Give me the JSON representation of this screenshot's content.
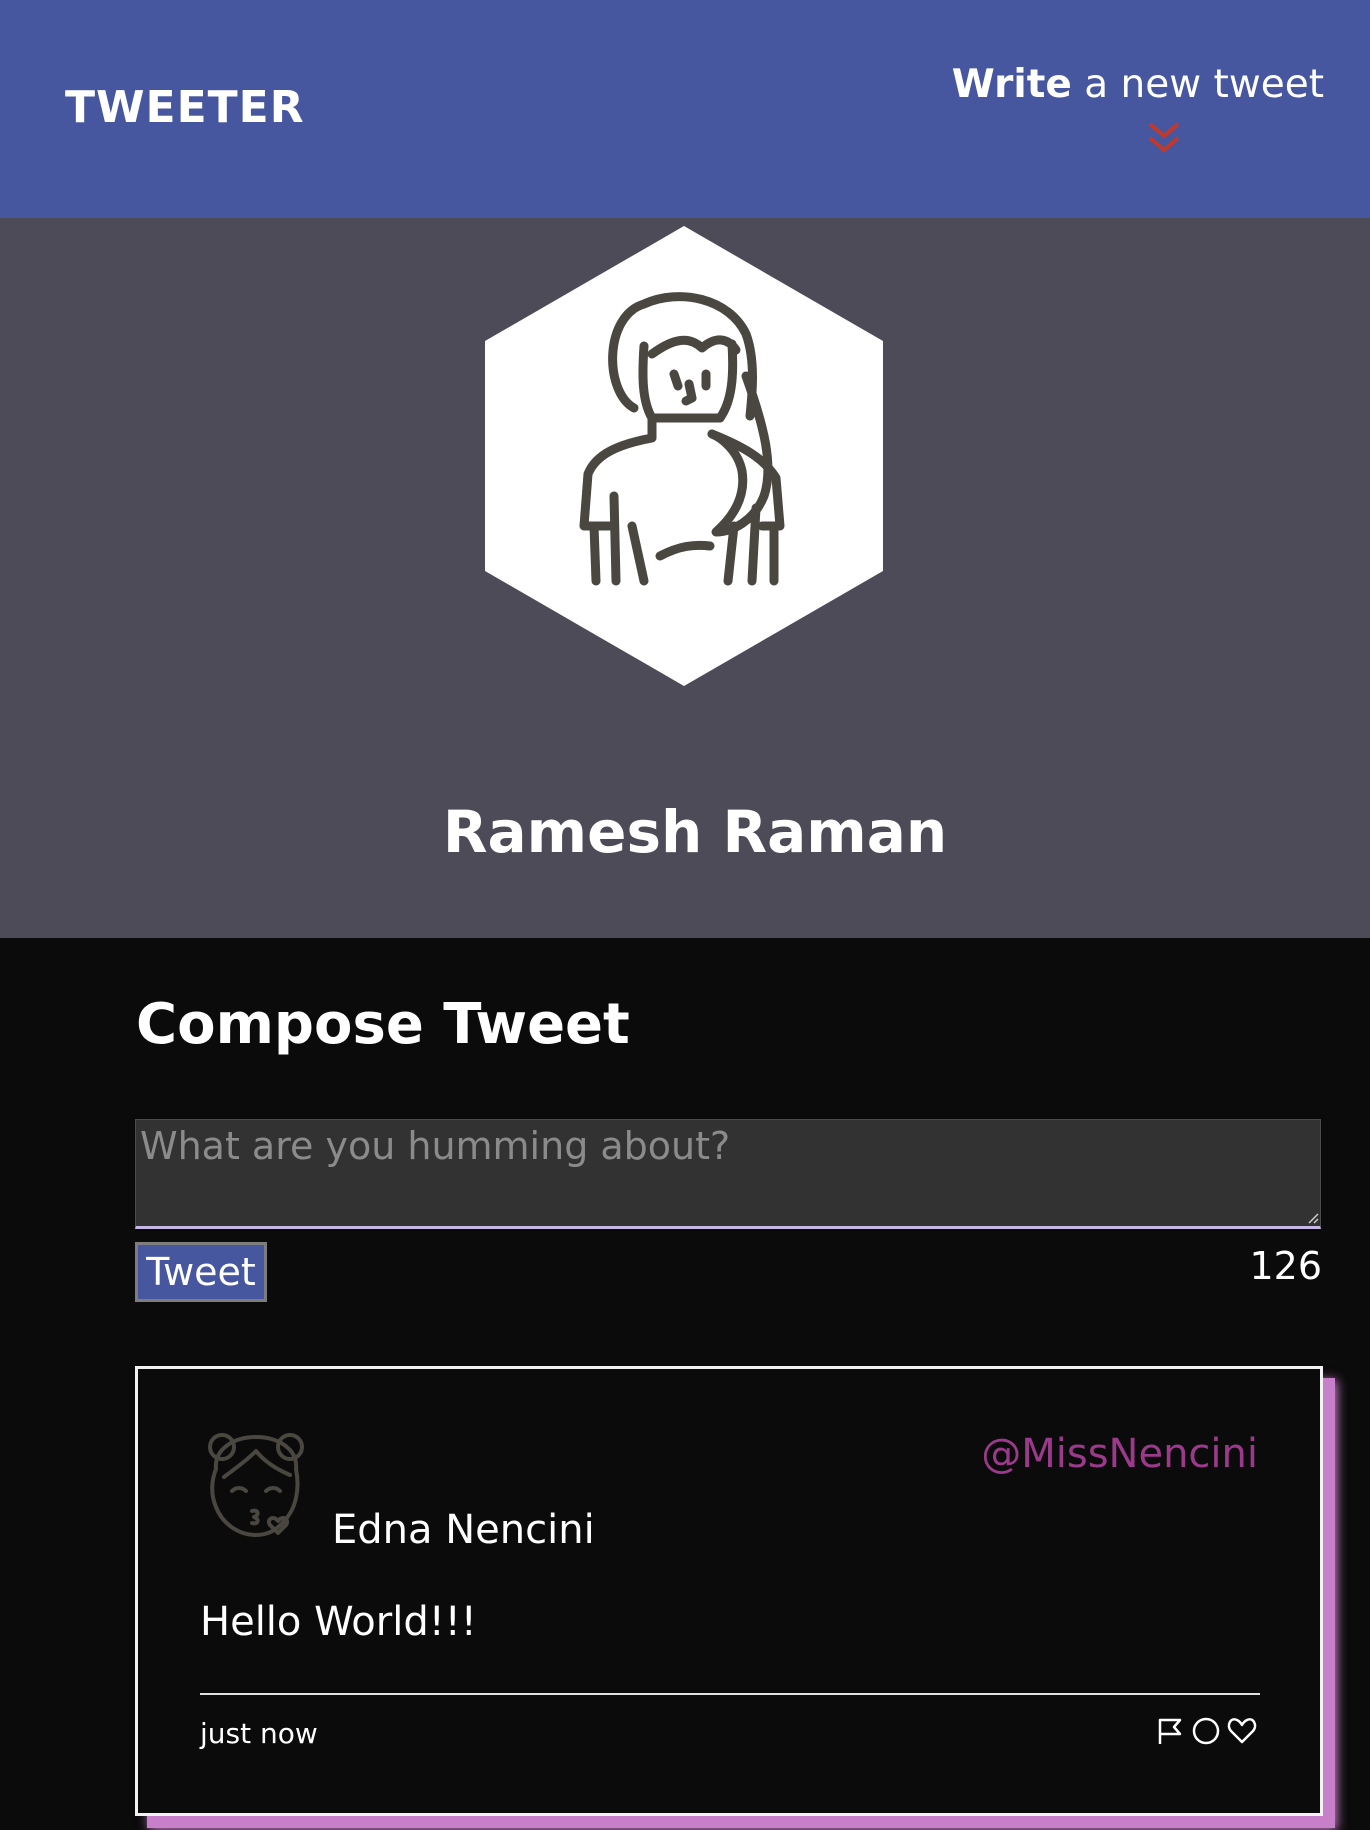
{
  "nav": {
    "brand": "TWEETER",
    "write_strong": "Write",
    "write_rest": " a new tweet"
  },
  "icons": {
    "compose_toggle": "double-chevron-down-icon",
    "profile_avatar": "woman-avatar-icon",
    "tweet_avatar": "girl-kiss-avatar-icon",
    "flag": "flag-icon",
    "retweet": "circle-retweet-icon",
    "like": "heart-icon"
  },
  "colors": {
    "nav_bg": "#4657a0",
    "profile_bg": "#4d4b57",
    "page_bg": "#0b0b0b",
    "accent_red": "#c0392b",
    "handle_color": "#9b3a8a",
    "card_shadow": "#c77fc9"
  },
  "profile": {
    "name": "Ramesh Raman"
  },
  "compose": {
    "title": "Compose Tweet",
    "placeholder": "What are you humming about?",
    "value": "",
    "button_label": "Tweet",
    "counter": "126"
  },
  "tweet": {
    "author": "Edna Nencini",
    "handle": "@MissNencini",
    "text": "Hello World!!!",
    "timestamp": "just now"
  }
}
